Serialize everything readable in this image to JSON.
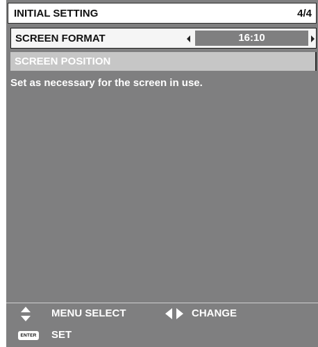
{
  "header": {
    "title": "INITIAL SETTING",
    "page": "4/4"
  },
  "screen_format": {
    "label": "SCREEN FORMAT",
    "value": "16:10"
  },
  "screen_position": {
    "label": "SCREEN POSITION"
  },
  "description": "Set as necessary for the screen in use.",
  "footer": {
    "menu_select": "MENU SELECT",
    "change": "CHANGE",
    "enter_key": "ENTER",
    "set": "SET"
  },
  "colors": {
    "panel": "#7f7f80",
    "selected_row": "#f5f5f5",
    "disabled_row": "#c6c6c6"
  },
  "icons": [
    "up-down-arrows-icon",
    "left-right-arrows-icon",
    "enter-key-icon",
    "left-arrow-icon",
    "right-arrow-icon"
  ]
}
